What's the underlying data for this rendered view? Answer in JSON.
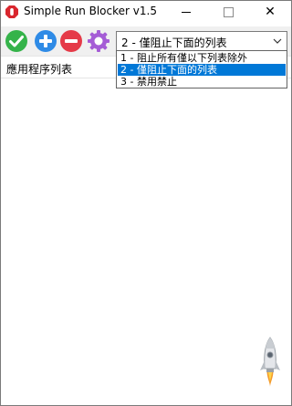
{
  "window": {
    "title": "Simple Run Blocker v1.5",
    "minimize_icon": "minimize-icon",
    "maximize_icon": "maximize-icon",
    "close_symbol": "✕"
  },
  "toolbar": {
    "icons": [
      "check-icon",
      "add-icon",
      "remove-icon",
      "settings-gear-icon"
    ],
    "mode_select": {
      "selected": "2 - 僅阻止下面的列表",
      "options": [
        "1 - 阻止所有僅以下列表除外",
        "2 - 僅阻止下面的列表",
        "3 - 禁用禁止"
      ],
      "highlighted_index": 1
    }
  },
  "list": {
    "header": "應用程序列表"
  },
  "colors": {
    "accent_check": "#35b34a",
    "accent_add": "#2f8be6",
    "accent_remove": "#e53a48",
    "accent_gear": "#a55cd6",
    "selection": "#0078d7"
  }
}
